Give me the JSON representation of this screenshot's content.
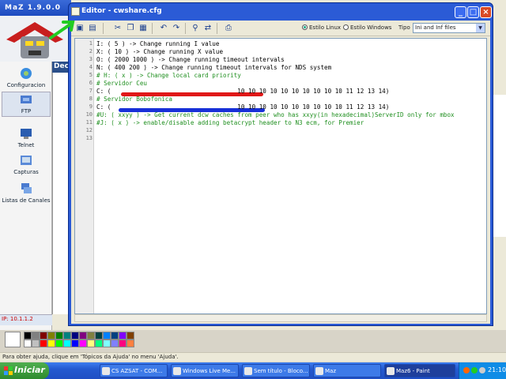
{
  "background_app": {
    "title": "MaZ 1.9.0.0",
    "panel_header": "Dec",
    "sidebar": [
      {
        "label": "Configuracion",
        "icon": "gear-globe-icon"
      },
      {
        "label": "FTP",
        "icon": "ftp-icon"
      },
      {
        "label": "Telnet",
        "icon": "telnet-icon"
      },
      {
        "label": "Capturas",
        "icon": "capture-icon"
      },
      {
        "label": "Listas de Canales",
        "icon": "channel-list-icon"
      }
    ],
    "ip": "IP: 10.1.1.2"
  },
  "editor": {
    "title": "Editor - cwshare.cfg",
    "radio_linux": "Estilo Linux",
    "radio_windows": "Estilo Windows",
    "selected_style": "linux",
    "tipo_label": "Tipo",
    "tipo_value": "Ini and Inf files",
    "lines": [
      {
        "n": "1",
        "text": "I: ( 5 ) -> Change running I value",
        "comment": false
      },
      {
        "n": "2",
        "text": "X: ( 10 ) -> Change running X value",
        "comment": false
      },
      {
        "n": "3",
        "text": "O: ( 2000 1000 ) -> Change running timeout intervals",
        "comment": false
      },
      {
        "n": "4",
        "text": "N: ( 400 200 ) -> Change running timeout intervals for NDS system",
        "comment": false
      },
      {
        "n": "5",
        "text": "# H: ( x ) -> Change local card priority",
        "comment": true
      },
      {
        "n": "6",
        "text": "# Servidor Ceu",
        "comment": true
      },
      {
        "n": "7",
        "text": "C: (                                   10 10 10 10 10 10 10 10 10 10 11 12 13 14)",
        "comment": false
      },
      {
        "n": "8",
        "text": "# Servidor Bobofonica",
        "comment": true
      },
      {
        "n": "9",
        "text": "C: (                                   10 10 10 10 10 10 10 10 10 10 11 12 13 14)",
        "comment": false
      },
      {
        "n": "10",
        "text": "#U: ( xxyy ) -> Get current dcw caches from peer who has xxyy(in hexadecimal)ServerID only for mbox",
        "comment": true
      },
      {
        "n": "11",
        "text": "#J: ( x ) -> enable/disable adding betacrypt header to N3 ecm, for Premier",
        "comment": true
      },
      {
        "n": "12",
        "text": "",
        "comment": false
      },
      {
        "n": "13",
        "text": "",
        "comment": false
      }
    ]
  },
  "paint": {
    "status_text": "Para obter ajuda, clique em 'Tópicos da Ajuda' no menu 'Ajuda'.",
    "palette": [
      "#000000",
      "#808080",
      "#800000",
      "#808000",
      "#008000",
      "#008080",
      "#000080",
      "#800080",
      "#808040",
      "#004040",
      "#0080ff",
      "#004080",
      "#8000ff",
      "#804000",
      "#ffffff",
      "#c0c0c0",
      "#ff0000",
      "#ffff00",
      "#00ff00",
      "#00ffff",
      "#0000ff",
      "#ff00ff",
      "#ffff80",
      "#00ff80",
      "#80ffff",
      "#8080ff",
      "#ff0080",
      "#ff8040"
    ]
  },
  "taskbar": {
    "start": "Iniciar",
    "tasks": [
      "CS AZSAT - COM...",
      "Windows Live Me...",
      "Sem título - Bloco...",
      "Maz",
      "Maz6 - Paint"
    ],
    "clock": "21:10"
  },
  "colors": {
    "redact_red": "#e01818",
    "redact_blue": "#1830d8",
    "annotation_green": "#22cc22"
  }
}
